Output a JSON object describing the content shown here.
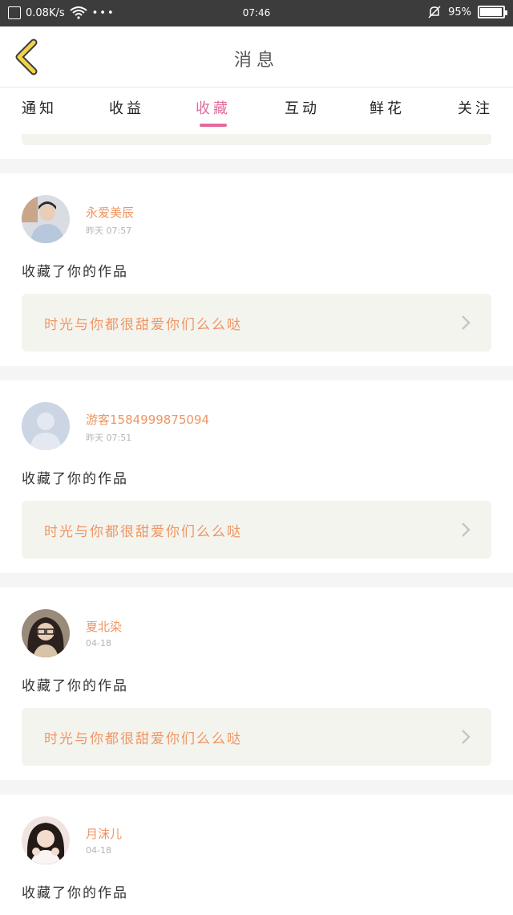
{
  "status_bar": {
    "net_speed": "0.08K/s",
    "time": "07:46",
    "battery_percent": "95%",
    "battery_level": 0.95
  },
  "header": {
    "title": "消息"
  },
  "tabs": [
    {
      "label": "通知"
    },
    {
      "label": "收益"
    },
    {
      "label": "收藏",
      "active": true
    },
    {
      "label": "互动"
    },
    {
      "label": "鲜花"
    },
    {
      "label": "关注"
    }
  ],
  "messages": [
    {
      "user": "永爱美辰",
      "time": "昨天 07:57",
      "action": "收藏了你的作品",
      "work": "时光与你都很甜爱你们么么哒",
      "avatar": "photo-male"
    },
    {
      "user": "游客15849998750​94",
      "time": "昨天 07:51",
      "action": "收藏了你的作品",
      "work": "时光与你都很甜爱你们么么哒",
      "avatar": "default-user"
    },
    {
      "user": "夏北染",
      "time": "04-18",
      "action": "收藏了你的作品",
      "work": "时光与你都很甜爱你们么么哒",
      "avatar": "photo-female"
    },
    {
      "user": "月沫儿",
      "time": "04-18",
      "action": "收藏了你的作品",
      "work": "",
      "avatar": "photo-female-2"
    }
  ],
  "colors": {
    "accent": "#e36a9b",
    "name": "#ee9663",
    "back_icon": "#f2d24a"
  }
}
